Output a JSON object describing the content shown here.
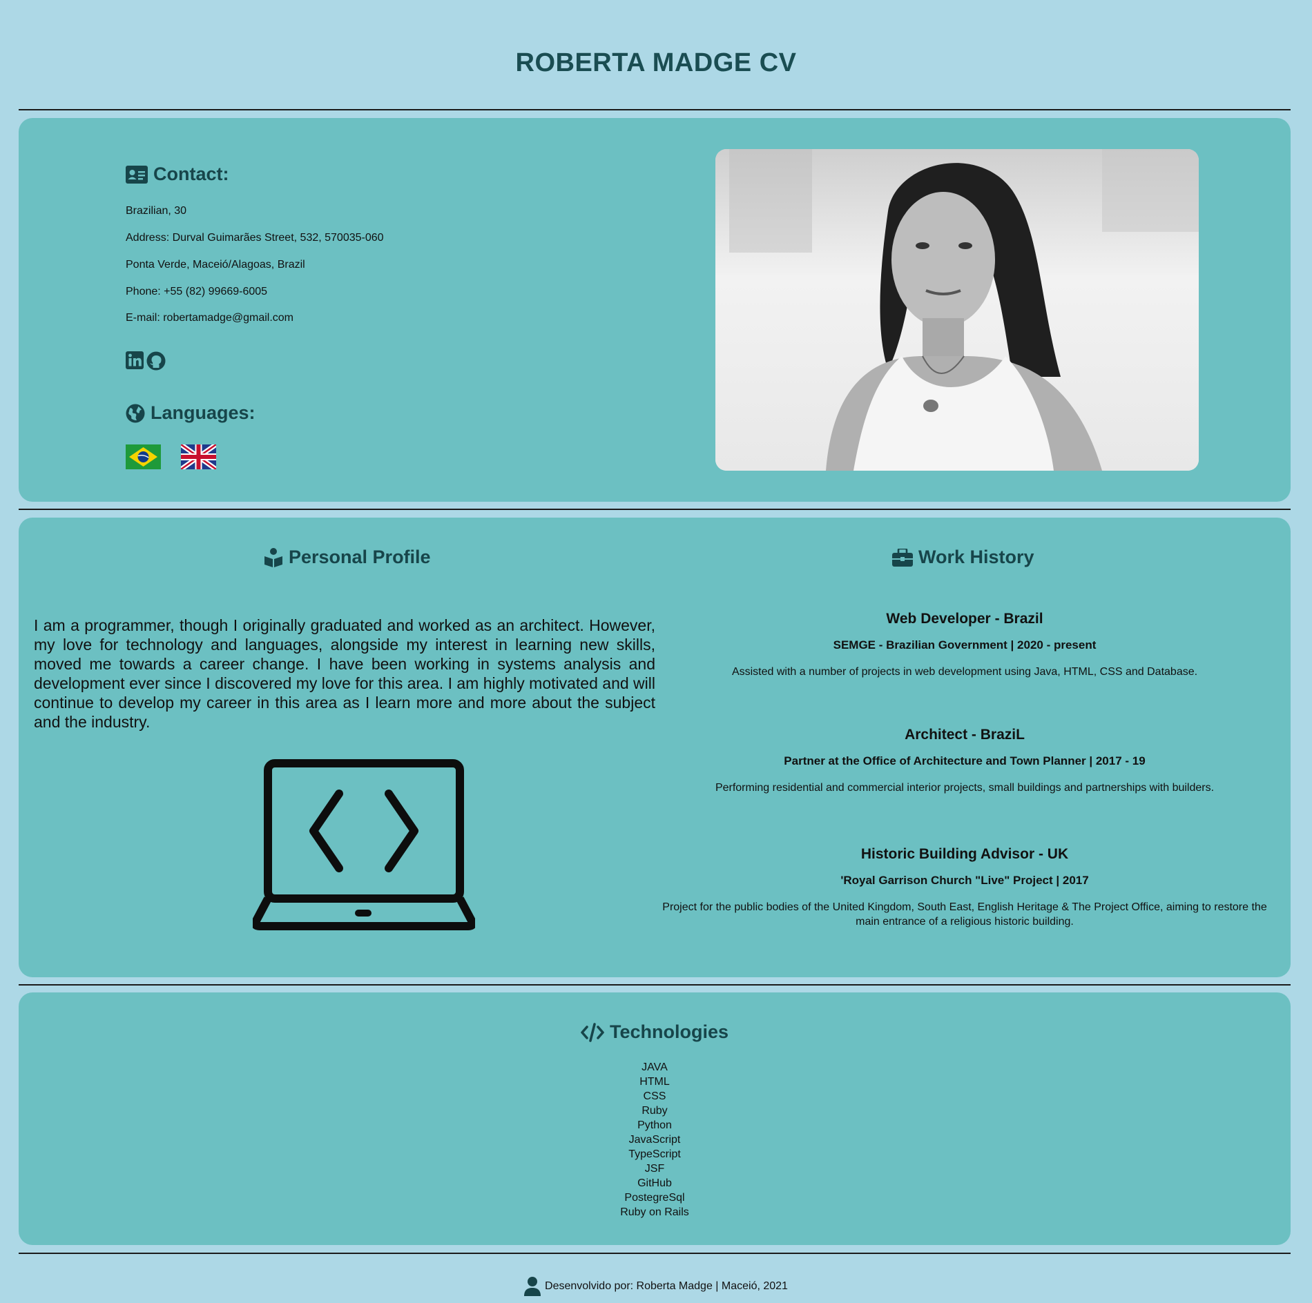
{
  "header": {
    "title": "ROBERTA MADGE CV"
  },
  "contact": {
    "heading": "Contact:",
    "nationality": "Brazilian, 30",
    "address": "Address: Durval Guimarães Street, 532, 570035-060",
    "city": "Ponta Verde, Maceió/Alagoas, Brazil",
    "phone": "Phone: +55 (82) 99669-6005",
    "email": "E-mail: robertamadge@gmail.com",
    "social_icons": [
      "linkedin-icon",
      "github-icon"
    ]
  },
  "languages": {
    "heading": "Languages:",
    "flags": [
      "brazil-flag",
      "uk-flag"
    ]
  },
  "profile": {
    "heading": "Personal Profile",
    "text": "I am a programmer, though I originally graduated and worked as an architect. However, my love for technology and languages, alongside my interest in learning new skills, moved me towards a career change. I have been working in systems analysis and development ever since I discovered my love for this area. I am highly motivated and will continue to develop my career in this area as I learn more and more about the subject and the industry."
  },
  "work": {
    "heading": "Work History",
    "jobs": [
      {
        "title": "Web Developer - Brazil",
        "company": "SEMGE - Brazilian Government | 2020 - present",
        "description": "Assisted with a number of projects in web development using Java, HTML, CSS and Database."
      },
      {
        "title": "Architect - BraziL",
        "company": "Partner at the Office of Architecture and Town Planner | 2017 - 19",
        "description": "Performing residential and commercial interior projects, small buildings and partnerships with builders."
      },
      {
        "title": "Historic Building Advisor - UK",
        "company": "'Royal Garrison Church \"Live\" Project | 2017",
        "description": "Project for the public bodies of the United Kingdom, South East, English Heritage & The Project Office, aiming to restore the main entrance of a religious historic building."
      }
    ]
  },
  "technologies": {
    "heading": "Technologies",
    "items": [
      "JAVA",
      "HTML",
      "CSS",
      "Ruby",
      "Python",
      "JavaScript",
      "TypeScript",
      "JSF",
      "GitHub",
      "PostegreSql",
      "Ruby on Rails"
    ]
  },
  "footer": {
    "text": "Desenvolvido por: Roberta Madge | Maceió, 2021"
  },
  "colors": {
    "page_background": "#add8e6",
    "panel_background": "#6cc0c2",
    "heading_color": "#17454a",
    "divider": "#1b1b1b"
  }
}
